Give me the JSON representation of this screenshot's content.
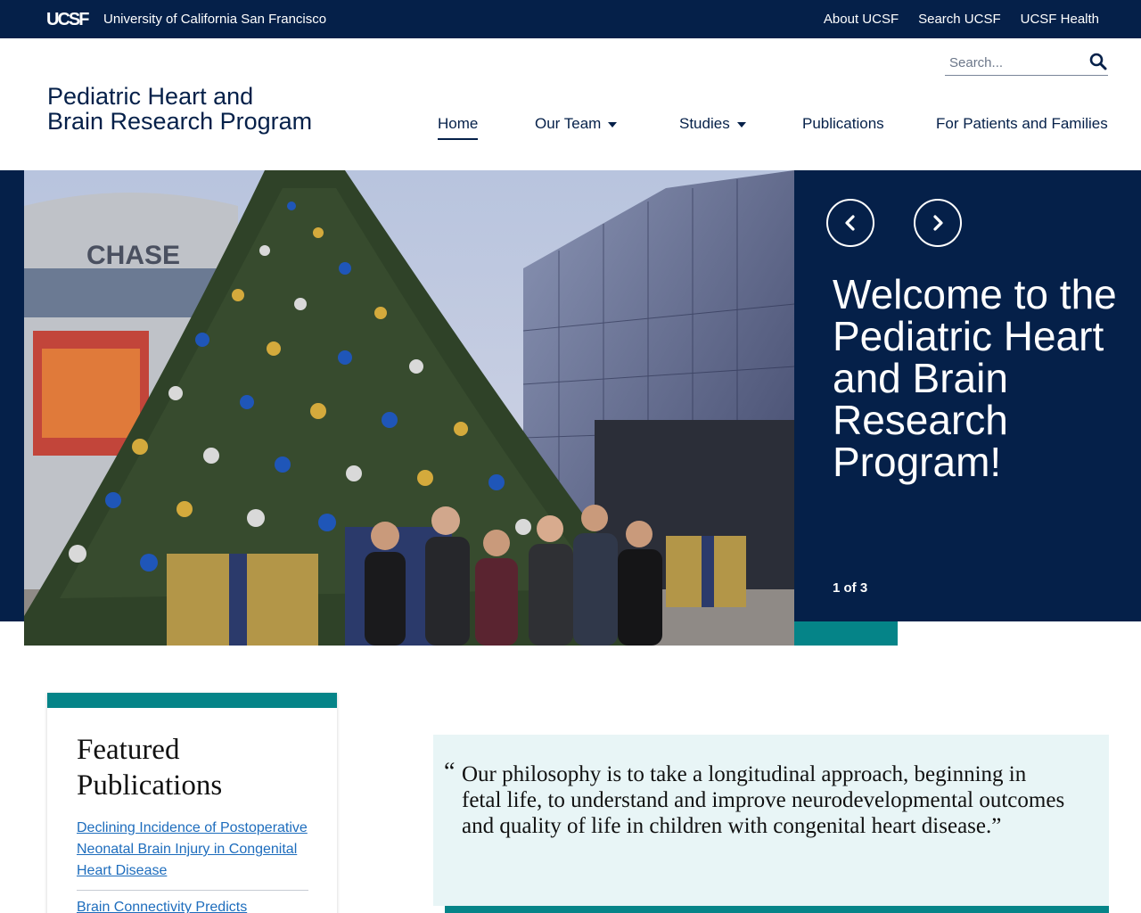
{
  "topbar": {
    "logo_text": "UCSF",
    "university": "University of California San Francisco",
    "links": [
      "About UCSF",
      "Search UCSF",
      "UCSF Health"
    ]
  },
  "header": {
    "site_name_line1": "Pediatric Heart and",
    "site_name_line2": "Brain Research Program",
    "search_placeholder": "Search..."
  },
  "nav": {
    "items": [
      {
        "label": "Home",
        "active": true
      },
      {
        "label": "Our Team",
        "dropdown": true
      },
      {
        "label": "Studies",
        "dropdown": true
      },
      {
        "label": "Publications"
      },
      {
        "label": "For Patients and Families"
      }
    ]
  },
  "hero": {
    "title": "Welcome to the Pediatric Heart and Brain Research Program!",
    "slide_counter": "1 of 3",
    "photo_sign_text": "CHASE",
    "prev_icon": "chevron-left-icon",
    "next_icon": "chevron-right-icon"
  },
  "featured": {
    "heading": "Featured Publications",
    "publications": [
      "Declining Incidence of Postoperative Neonatal Brain Injury in Congenital Heart Disease",
      "Brain Connectivity Predicts"
    ]
  },
  "quote": {
    "mark": "“",
    "text": "Our philosophy is to take a longitudinal approach, beginning in fetal life, to understand and improve neurodevelopmental outcomes and quality of life in children with congenital heart disease.”"
  },
  "colors": {
    "navy": "#052049",
    "teal": "#058488",
    "quote_bg": "#e8f5f6",
    "link": "#1e6dbd"
  }
}
